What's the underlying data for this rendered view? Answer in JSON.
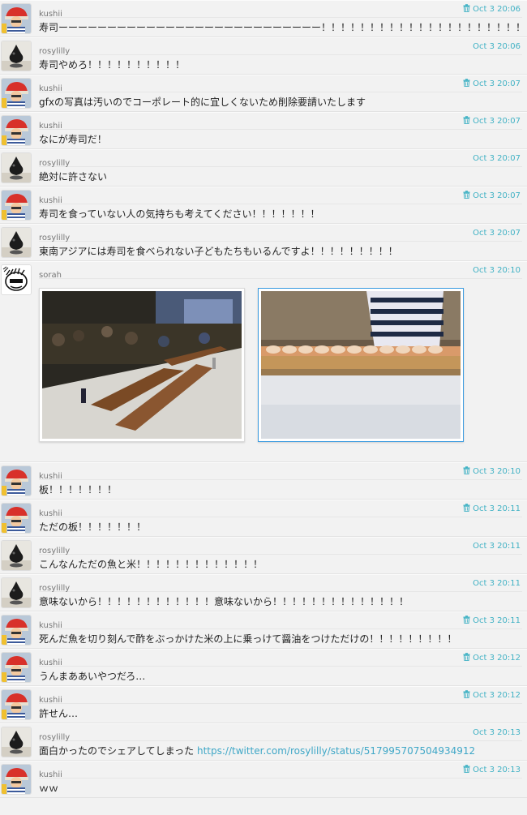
{
  "messages": [
    {
      "user": "kushii",
      "avatar": "kushii",
      "time": "Oct 3 20:06",
      "deletable": true,
      "text": "寿司ーーーーーーーーーーーーーーーーーーーーーーーーーーー！！！！！！！！！！！！！！！！！！！！！！"
    },
    {
      "user": "rosylilly",
      "avatar": "rosylilly",
      "time": "Oct 3 20:06",
      "deletable": false,
      "text": "寿司やめろ！！！！！！！！！！"
    },
    {
      "user": "kushii",
      "avatar": "kushii",
      "time": "Oct 3 20:07",
      "deletable": true,
      "text": "gfxの写真は汚いのでコーポレート的に宜しくないため削除要請いたします"
    },
    {
      "user": "kushii",
      "avatar": "kushii",
      "time": "Oct 3 20:07",
      "deletable": true,
      "text": "なにが寿司だ！"
    },
    {
      "user": "rosylilly",
      "avatar": "rosylilly",
      "time": "Oct 3 20:07",
      "deletable": false,
      "text": "絶対に許さない"
    },
    {
      "user": "kushii",
      "avatar": "kushii",
      "time": "Oct 3 20:07",
      "deletable": true,
      "text": "寿司を食っていない人の気持ちも考えてください！！！！！！！"
    },
    {
      "user": "rosylilly",
      "avatar": "rosylilly",
      "time": "Oct 3 20:07",
      "deletable": false,
      "text": "東南アジアには寿司を食べられない子どもたちもいるんですよ！！！！！！！！！"
    },
    {
      "user": "sorah",
      "avatar": "sorah",
      "time": "Oct 3 20:10",
      "deletable": false,
      "text": "",
      "images": [
        "event-venue-photo",
        "sushi-counter-photo"
      ]
    },
    {
      "user": "kushii",
      "avatar": "kushii",
      "time": "Oct 3 20:10",
      "deletable": true,
      "text": "板！！！！！！！"
    },
    {
      "user": "kushii",
      "avatar": "kushii",
      "time": "Oct 3 20:11",
      "deletable": true,
      "text": "ただの板！！！！！！！"
    },
    {
      "user": "rosylilly",
      "avatar": "rosylilly",
      "time": "Oct 3 20:11",
      "deletable": false,
      "text": "こんなんただの魚と米！！！！！！！！！！！！！"
    },
    {
      "user": "rosylilly",
      "avatar": "rosylilly",
      "time": "Oct 3 20:11",
      "deletable": false,
      "text": "意味ないから！！！！！！！！！！！！意味ないから！！！！！！！！！！！！！！"
    },
    {
      "user": "kushii",
      "avatar": "kushii",
      "time": "Oct 3 20:11",
      "deletable": true,
      "text": "死んだ魚を切り刻んで酢をぶっかけた米の上に乗っけて醤油をつけただけの！！！！！！！！！"
    },
    {
      "user": "kushii",
      "avatar": "kushii",
      "time": "Oct 3 20:12",
      "deletable": true,
      "text": "うんまああいやつだろ…"
    },
    {
      "user": "kushii",
      "avatar": "kushii",
      "time": "Oct 3 20:12",
      "deletable": true,
      "text": "許せん…"
    },
    {
      "user": "rosylilly",
      "avatar": "rosylilly",
      "time": "Oct 3 20:13",
      "deletable": false,
      "text": "面白かったのでシェアしてしまった ",
      "link": "https://twitter.com/rosylilly/status/517995707504934912"
    },
    {
      "user": "kushii",
      "avatar": "kushii",
      "time": "Oct 3 20:13",
      "deletable": true,
      "text": "ｗｗ"
    }
  ],
  "icons": {
    "delete": "trash-icon"
  },
  "colors": {
    "timestamp": "#3fb1c4",
    "link": "#3fa7c7",
    "selected_border": "#3a9be0"
  }
}
